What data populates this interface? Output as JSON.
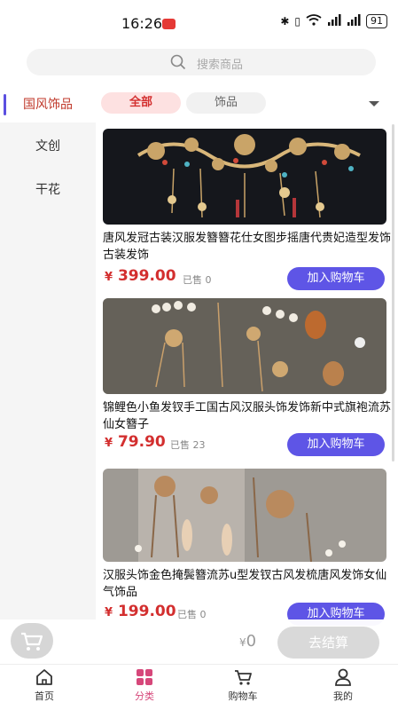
{
  "status_bar": {
    "time": "16:26",
    "battery": "91",
    "network": "4G"
  },
  "search": {
    "placeholder": "搜索商品",
    "icon": "search-icon"
  },
  "sidebar": {
    "items": [
      {
        "label": "国风饰品",
        "active": true
      },
      {
        "label": "文创",
        "active": false
      },
      {
        "label": "干花",
        "active": false
      }
    ]
  },
  "filters": {
    "chips": [
      {
        "label": "全部",
        "active": true
      },
      {
        "label": "饰品",
        "active": false
      }
    ],
    "expand_icon": "chevron-down-icon"
  },
  "products": [
    {
      "title": "唐风发冠古装汉服发簪簪花仕女图步摇唐代贵妃造型发饰古装发饰",
      "price_symbol": "¥",
      "price": "399.00",
      "sold": "已售 0",
      "button": "加入购物车",
      "image": "gold-hairpin-ornament-photo"
    },
    {
      "title": "锦鲤色小鱼发钗手工国古风汉服头饰发饰新中式旗袍流苏仙女簪子",
      "price_symbol": "¥",
      "price": "79.90",
      "sold": "已售 23",
      "button": "加入购物车",
      "image": "pearl-tassel-hairpin-photo"
    },
    {
      "title": "汉服头饰金色掩鬓簪流苏u型发钗古风发梳唐风发饰女仙气饰品",
      "price_symbol": "¥",
      "price": "199.00",
      "sold": "已售 0",
      "button": "加入购物车",
      "image": "butterfly-tassel-hairpin-photo"
    }
  ],
  "cart_bar": {
    "total_symbol": "¥",
    "total": "0",
    "checkout": "去结算",
    "cart_icon": "cart-icon"
  },
  "tabbar": {
    "tabs": [
      {
        "label": "首页",
        "icon": "home-icon",
        "active": false
      },
      {
        "label": "分类",
        "icon": "category-icon",
        "active": true
      },
      {
        "label": "购物车",
        "icon": "cart-icon",
        "active": false
      },
      {
        "label": "我的",
        "icon": "profile-icon",
        "active": false
      }
    ]
  },
  "colors": {
    "accent": "#5e55e6",
    "price": "#d32f2f",
    "active_tab": "#d6477a"
  }
}
